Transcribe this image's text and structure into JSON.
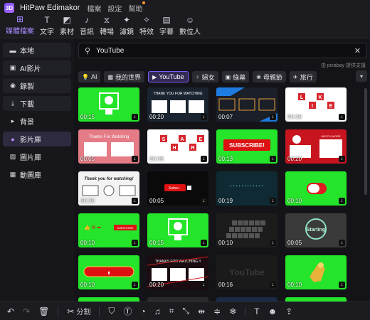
{
  "app": {
    "name": "HitPaw Edimakor",
    "logo_text": "3D"
  },
  "menu": [
    "檔案",
    "設定",
    "幫助"
  ],
  "toolbar": [
    {
      "label": "媒體檔案",
      "icon": "folder-icon",
      "glyph": "⊞",
      "active": true
    },
    {
      "label": "文字",
      "icon": "text-icon",
      "glyph": "T",
      "active": false
    },
    {
      "label": "素材",
      "icon": "material-icon",
      "glyph": "◩",
      "active": false
    },
    {
      "label": "音訊",
      "icon": "music-icon",
      "glyph": "♪",
      "active": false
    },
    {
      "label": "轉場",
      "icon": "transition-icon",
      "glyph": "⧖",
      "active": false
    },
    {
      "label": "濾鏡",
      "icon": "filter-icon",
      "glyph": "✦",
      "active": false
    },
    {
      "label": "特效",
      "icon": "effect-icon",
      "glyph": "✧",
      "active": false
    },
    {
      "label": "字幕",
      "icon": "subtitle-icon",
      "glyph": "▤",
      "active": false
    },
    {
      "label": "數位人",
      "icon": "avatar-icon",
      "glyph": "☺",
      "active": false
    }
  ],
  "sidebar": [
    {
      "label": "本地",
      "icon": "folder-icon",
      "glyph": "▬",
      "style": "box"
    },
    {
      "label": "AI影片",
      "icon": "ai-video-icon",
      "glyph": "▣",
      "style": "box"
    },
    {
      "label": "錄製",
      "icon": "record-icon",
      "glyph": "◉",
      "style": "box"
    },
    {
      "label": "下載",
      "icon": "download-icon",
      "glyph": "⤓",
      "style": "box"
    },
    {
      "label": "背景",
      "icon": "chevron-right-icon",
      "glyph": "▸",
      "style": "plain"
    },
    {
      "label": "影片庫",
      "icon": "video-library-icon",
      "glyph": "●",
      "style": "active"
    },
    {
      "label": "圖片庫",
      "icon": "image-library-icon",
      "glyph": "▨",
      "style": "plain"
    },
    {
      "label": "動圖庫",
      "icon": "gif-library-icon",
      "glyph": "▦",
      "style": "plain"
    }
  ],
  "search": {
    "value": "YouTube",
    "placeholder": ""
  },
  "credit": "由 pixabay 提供支援",
  "chips": [
    {
      "label": "AI",
      "icon": "bulb-icon",
      "glyph": "💡",
      "active": false
    },
    {
      "label": "我的世界",
      "icon": "minecraft-icon",
      "glyph": "▩",
      "active": false
    },
    {
      "label": "YouTube",
      "icon": "youtube-icon",
      "glyph": "▶",
      "active": true
    },
    {
      "label": "婦女",
      "icon": "women-icon",
      "glyph": "♀",
      "active": false
    },
    {
      "label": "綠幕",
      "icon": "green-screen-icon",
      "glyph": "▣",
      "active": false
    },
    {
      "label": "母親節",
      "icon": "mothers-day-icon",
      "glyph": "❀",
      "active": false
    },
    {
      "label": "旅行",
      "icon": "travel-icon",
      "glyph": "✈",
      "active": false
    }
  ],
  "clips": [
    {
      "duration": "00:15",
      "bg": "#24e52a",
      "art": "subscribe-window",
      "text": ""
    },
    {
      "duration": "00:20",
      "bg": "#1a2430",
      "art": "thanks-frames",
      "text": "THANK YOU FOR WATCHING"
    },
    {
      "duration": "00:07",
      "bg": "#1b1f28",
      "art": "blue-stripe-frames",
      "text": ""
    },
    {
      "duration": "00:06",
      "bg": "#ffffff",
      "art": "like-tiles",
      "text": "LIKE"
    },
    {
      "duration": "00:05",
      "bg": "#e47b86",
      "art": "thanks-pink",
      "text": "Thanks For Watching"
    },
    {
      "duration": "00:06",
      "bg": "#ffffff",
      "art": "share-tiles",
      "text": "SHARE"
    },
    {
      "duration": "00:13",
      "bg": "#24e52a",
      "art": "subscribe-red",
      "text": "SUBSCRIBE!"
    },
    {
      "duration": "00:20",
      "bg": "#c8141e",
      "art": "red-subscribe-watch",
      "text": "WATCH MORE"
    },
    {
      "duration": "00:20",
      "bg": "#f3f3f3",
      "art": "thanks-light",
      "text": "Thank you for watching!"
    },
    {
      "duration": "00:05",
      "bg": "#0a0a0a",
      "art": "dark-subscribe-bar",
      "text": "Subsc..."
    },
    {
      "duration": "00:19",
      "bg": "#0f2a33",
      "art": "particles",
      "text": ""
    },
    {
      "duration": "00:10",
      "bg": "#24e52a",
      "art": "red-toggle",
      "text": ""
    },
    {
      "duration": "00:10",
      "bg": "#24e52a",
      "art": "like-comment-subscribe",
      "text": "SUBSCRIBE"
    },
    {
      "duration": "00:15",
      "bg": "#24e52a",
      "art": "bell-window",
      "text": ""
    },
    {
      "duration": "00:10",
      "bg": "#1c1c1c",
      "art": "dark-cubes",
      "text": ""
    },
    {
      "duration": "00:05",
      "bg": "#3a3a3a",
      "art": "starting-logo",
      "text": "Starting"
    },
    {
      "duration": "00:10",
      "bg": "#24e52a",
      "art": "red-pill-bar",
      "text": ""
    },
    {
      "duration": "00:20",
      "bg": "#1a0c10",
      "art": "thanks-red-lines",
      "text": "THANKS FOR WATCHING !!"
    },
    {
      "duration": "00:16",
      "bg": "#1a1a1a",
      "art": "youtube-dark",
      "text": "YouTube"
    },
    {
      "duration": "00:10",
      "bg": "#24e52a",
      "art": "gold-hand",
      "text": ""
    }
  ],
  "bottombar": {
    "split_label": "分割",
    "buttons": [
      {
        "icon": "undo-icon",
        "glyph": "↶",
        "dim": false
      },
      {
        "icon": "redo-icon",
        "glyph": "↷",
        "dim": true
      },
      {
        "icon": "trash-icon",
        "glyph": "🗑",
        "dim": false
      },
      {
        "icon": "split-icon",
        "glyph": "✂",
        "dim": false,
        "has_label": true
      },
      {
        "icon": "mask-icon",
        "glyph": "⛉",
        "dim": false
      },
      {
        "icon": "text-box-icon",
        "glyph": "Ⓣ",
        "dim": false
      },
      {
        "icon": "speed-icon",
        "glyph": "◔",
        "dim": false
      },
      {
        "icon": "audio-detach-icon",
        "glyph": "♫",
        "dim": false
      },
      {
        "icon": "crop-icon",
        "glyph": "⌗",
        "dim": false
      },
      {
        "icon": "resize-icon",
        "glyph": "⤡",
        "dim": false
      },
      {
        "icon": "flip-icon",
        "glyph": "⇹",
        "dim": false
      },
      {
        "icon": "adjust-icon",
        "glyph": "≑",
        "dim": false
      },
      {
        "icon": "freeze-icon",
        "glyph": "❄",
        "dim": false
      },
      {
        "icon": "text-tool-icon",
        "glyph": "T",
        "dim": false
      },
      {
        "icon": "face-icon",
        "glyph": "☻",
        "dim": false
      },
      {
        "icon": "export-icon",
        "glyph": "⇪",
        "dim": false
      }
    ]
  }
}
